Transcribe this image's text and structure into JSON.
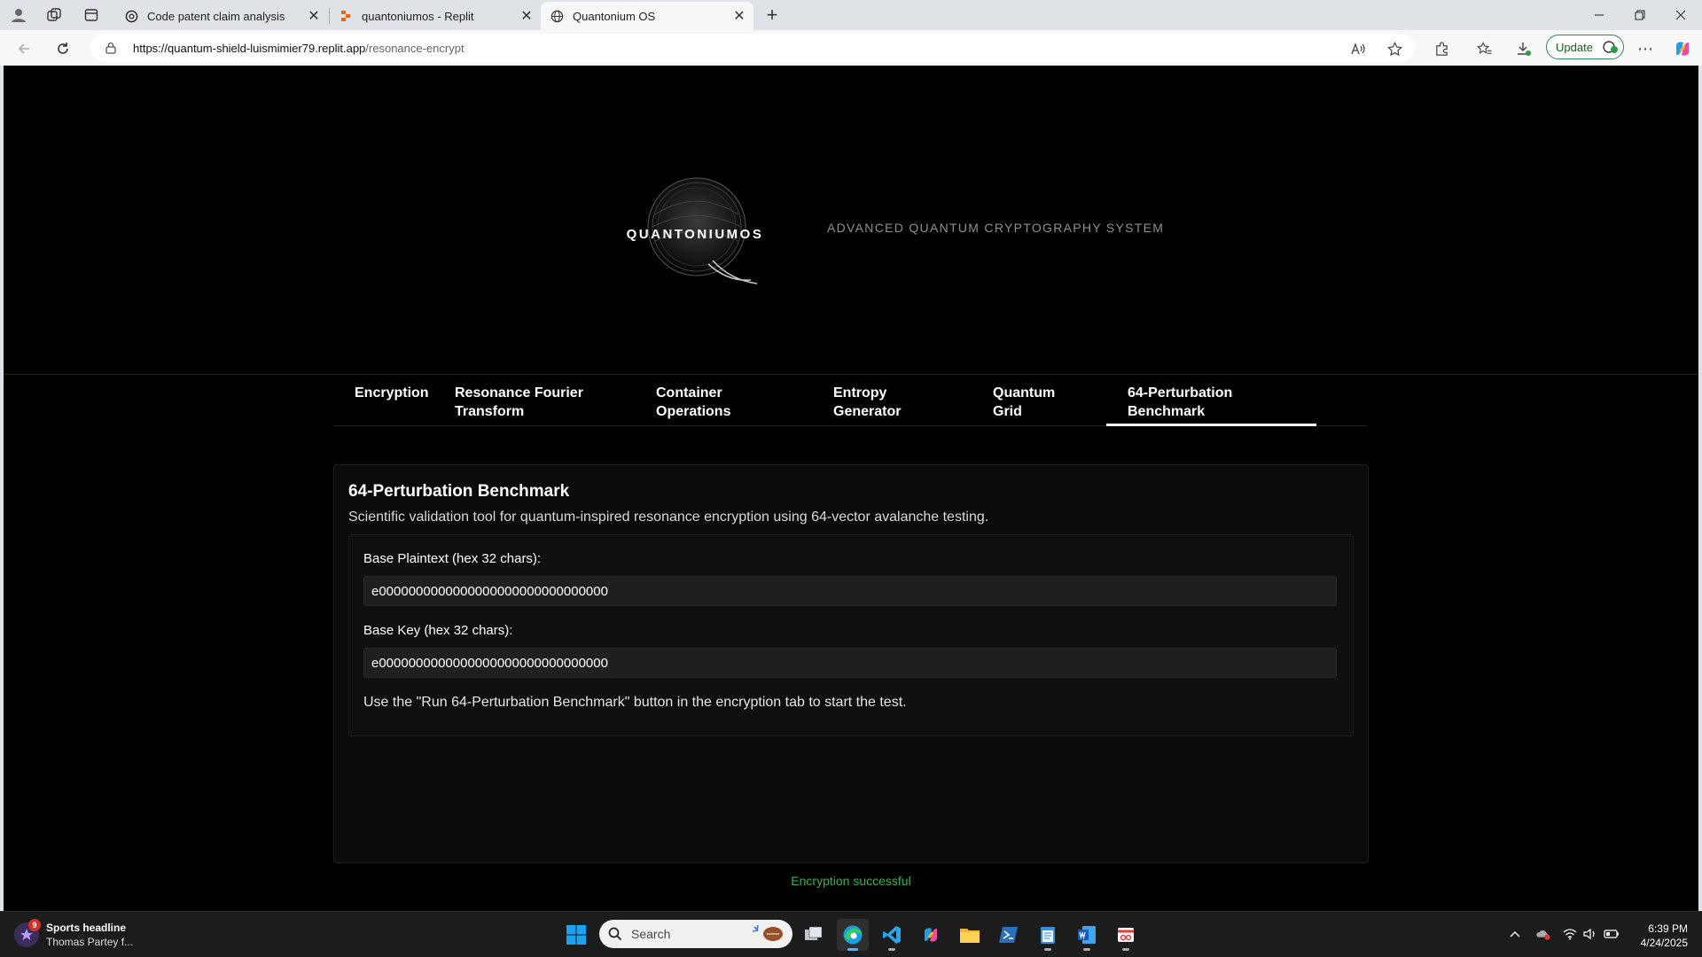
{
  "browser": {
    "tabs": [
      {
        "title": "Code patent claim analysis"
      },
      {
        "title": "quantoniumos - Replit"
      },
      {
        "title": "Quantonium OS"
      }
    ],
    "url_host": "https://quantum-shield-luismimier79.replit.app",
    "url_path": "/resonance-encrypt",
    "update_label": "Update"
  },
  "header": {
    "logo_text": "QUANTONIUMOS",
    "tagline": "ADVANCED QUANTUM CRYPTOGRAPHY SYSTEM"
  },
  "nav": {
    "tabs": [
      {
        "line1": "Encryption",
        "line2": ""
      },
      {
        "line1": "Resonance Fourier",
        "line2": "Transform"
      },
      {
        "line1": "Container",
        "line2": "Operations"
      },
      {
        "line1": "Entropy",
        "line2": "Generator"
      },
      {
        "line1": "Quantum",
        "line2": "Grid"
      },
      {
        "line1": "64-Perturbation",
        "line2": "Benchmark"
      }
    ],
    "active": "64-Perturbation Benchmark"
  },
  "panel": {
    "title": "64-Perturbation Benchmark",
    "description": "Scientific validation tool for quantum-inspired resonance encryption using 64-vector avalanche testing.",
    "plaintext_label": "Base Plaintext (hex 32 chars):",
    "plaintext_value": "e0000000000000000000000000000000",
    "key_label": "Base Key (hex 32 chars):",
    "key_value": "e0000000000000000000000000000000",
    "note": "Use the \"Run 64-Perturbation Benchmark\" button in the encryption tab to start the test."
  },
  "status": "Encryption successful",
  "taskbar": {
    "widget_title": "Sports headline",
    "widget_sub": "Thomas Partey f...",
    "widget_badge": "9",
    "search_label": "Search",
    "time": "6:39 PM",
    "date": "4/24/2025"
  },
  "colors": {
    "page_bg": "#000000",
    "status_green": "#38b24a",
    "panel_bg": "#0b0b0b",
    "input_bg": "#1f1f1f"
  }
}
